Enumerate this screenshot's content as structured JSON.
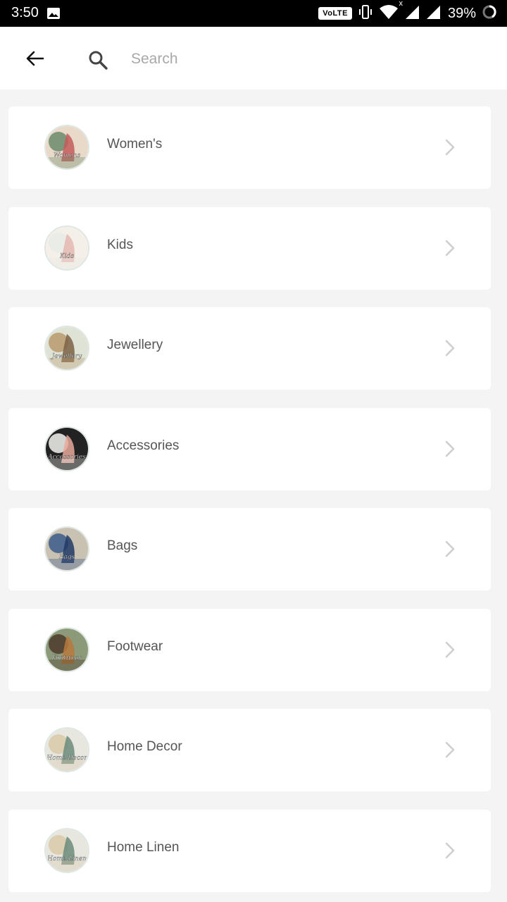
{
  "status_bar": {
    "time": "3:50",
    "network_badge": "VoLTE",
    "roaming_marker": "x",
    "battery": "39%"
  },
  "header": {
    "search_placeholder": "Search"
  },
  "categories": [
    {
      "label": "Women's",
      "thumb_text": "Womens",
      "colors": [
        "#6b8b6c",
        "#c45a5a",
        "#e8d9c8"
      ]
    },
    {
      "label": "Kids",
      "thumb_text": "Kids",
      "colors": [
        "#e7ece6",
        "#e3b7b0",
        "#f4efe8"
      ]
    },
    {
      "label": "Jewellery",
      "thumb_text": "Jewellery",
      "colors": [
        "#b99a6f",
        "#7c6244",
        "#dfe3d6"
      ]
    },
    {
      "label": "Accessories",
      "thumb_text": "Accessories",
      "colors": [
        "#f2f2ee",
        "#e8a89a",
        "#222222"
      ]
    },
    {
      "label": "Bags",
      "thumb_text": "Bags",
      "colors": [
        "#3c5a8a",
        "#203a66",
        "#c9c1b1"
      ]
    },
    {
      "label": "Footwear",
      "thumb_text": "Footwear",
      "colors": [
        "#4c3a2a",
        "#b7793c",
        "#8c9a7a"
      ]
    },
    {
      "label": "Home Decor",
      "thumb_text": "Home Decor",
      "colors": [
        "#d8c9a8",
        "#6b8b7a",
        "#e7e7e0"
      ]
    },
    {
      "label": "Home Linen",
      "thumb_text": "Home Linen",
      "colors": [
        "#d8c9a8",
        "#6b8b7a",
        "#e7e7e0"
      ]
    }
  ]
}
